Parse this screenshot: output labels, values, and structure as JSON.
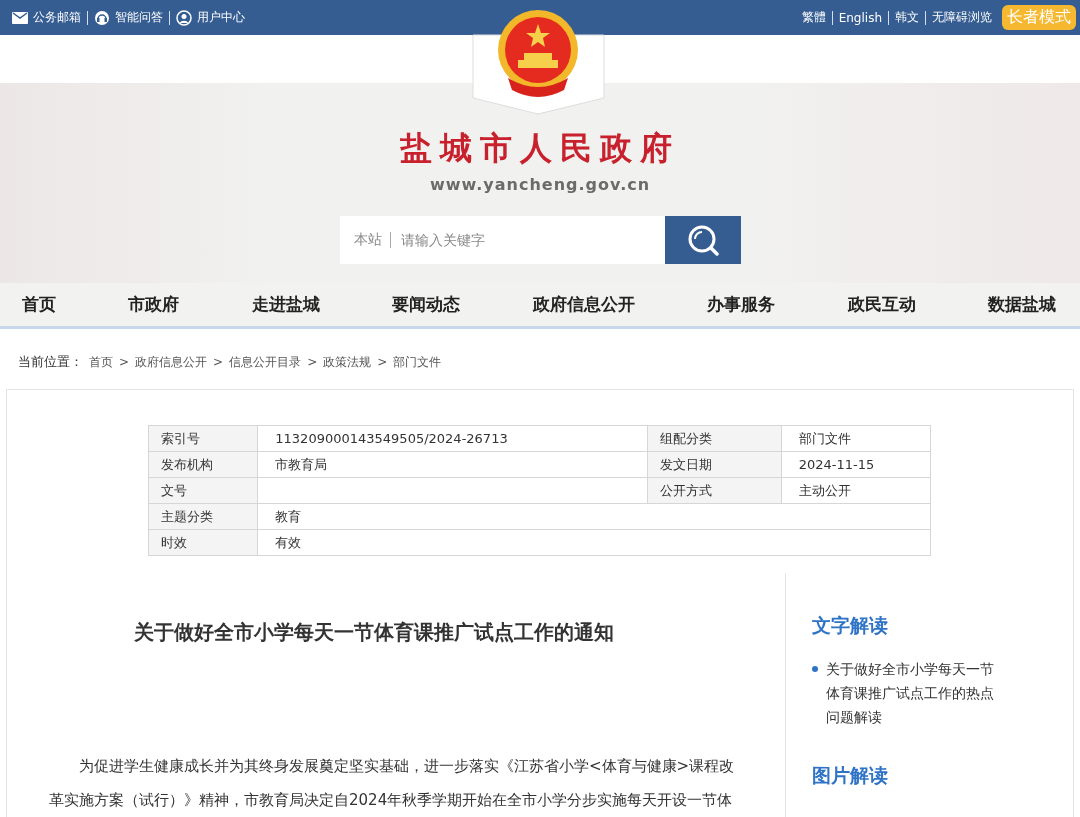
{
  "top_bar": {
    "left_links": [
      {
        "label": "公务邮箱"
      },
      {
        "label": "智能问答"
      },
      {
        "label": "用户中心"
      }
    ],
    "right_links": [
      {
        "label": "繁體"
      },
      {
        "label": "English"
      },
      {
        "label": "韩文"
      },
      {
        "label": "无障碍浏览"
      }
    ],
    "elder_mode": "长者模式"
  },
  "site": {
    "title": "盐城市人民政府",
    "url": "www.yancheng.gov.cn"
  },
  "search": {
    "scope": "本站",
    "placeholder": "请输入关键字"
  },
  "nav": [
    {
      "label": "首页"
    },
    {
      "label": "市政府"
    },
    {
      "label": "走进盐城"
    },
    {
      "label": "要闻动态"
    },
    {
      "label": "政府信息公开"
    },
    {
      "label": "办事服务"
    },
    {
      "label": "政民互动"
    },
    {
      "label": "数据盐城"
    }
  ],
  "breadcrumb": {
    "label": "当前位置：",
    "separator": ">",
    "items": [
      "首页",
      "政府信息公开",
      "信息公开目录",
      "政策法规",
      "部门文件"
    ]
  },
  "info_table": {
    "rows": [
      {
        "cells": [
          {
            "label": "索引号",
            "value": "113209000143549505/2024-26713"
          },
          {
            "label": "组配分类",
            "value": "部门文件"
          }
        ]
      },
      {
        "cells": [
          {
            "label": "发布机构",
            "value": "市教育局"
          },
          {
            "label": "发文日期",
            "value": "2024-11-15"
          }
        ]
      },
      {
        "cells": [
          {
            "label": "文号"
          },
          {
            "label": "公开方式",
            "value": "主动公开"
          }
        ]
      },
      {
        "cells": [
          {
            "label": "主题分类",
            "value": "教育"
          }
        ]
      },
      {
        "cells": [
          {
            "label": "时效",
            "value": "有效"
          }
        ]
      }
    ]
  },
  "article": {
    "title": "关于做好全市小学每天一节体育课推广试点工作的通知",
    "paragraphs": [
      "为促进学生健康成长并为其终身发展奠定坚实基础，进一步落实《江苏省小学<体育与健康>课程改革实施方案（试行）》精神，市教育局决定自2024年秋季学期开始在全市小学分步实施每天开设一节体"
    ]
  },
  "sidebar": [
    {
      "heading": "文字解读",
      "items": [
        "关于做好全市小学每天一节体育课推广试点工作的热点问题解读"
      ]
    },
    {
      "heading": "图片解读"
    }
  ]
}
